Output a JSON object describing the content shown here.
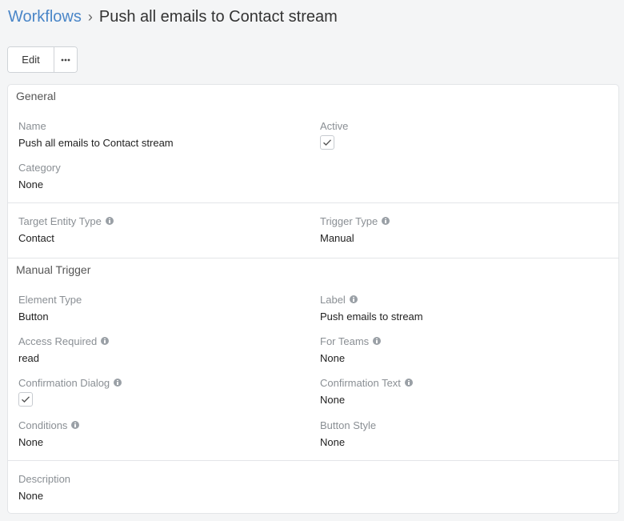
{
  "breadcrumb": {
    "parent": "Workflows",
    "separator": "›",
    "current": "Push all emails to Contact stream"
  },
  "toolbar": {
    "edit_label": "Edit",
    "more_icon": "more-horizontal-icon"
  },
  "general": {
    "title": "General",
    "name_label": "Name",
    "name_value": "Push all emails to Contact stream",
    "active_label": "Active",
    "active_checked": true,
    "category_label": "Category",
    "category_value": "None",
    "target_label": "Target Entity Type",
    "target_value": "Contact",
    "trigger_type_label": "Trigger Type",
    "trigger_type_value": "Manual"
  },
  "manual_trigger": {
    "title": "Manual Trigger",
    "element_type_label": "Element Type",
    "element_type_value": "Button",
    "label_label": "Label",
    "label_value": "Push emails to stream",
    "access_label": "Access Required",
    "access_value": "read",
    "teams_label": "For Teams",
    "teams_value": "None",
    "confirm_dialog_label": "Confirmation Dialog",
    "confirm_dialog_checked": true,
    "confirm_text_label": "Confirmation Text",
    "confirm_text_value": "None",
    "conditions_label": "Conditions",
    "conditions_value": "None",
    "button_style_label": "Button Style",
    "button_style_value": "None"
  },
  "description": {
    "label": "Description",
    "value": "None"
  },
  "colors": {
    "link": "#4a86c8",
    "label": "#8a8f94",
    "info_icon": "#9aa0a6"
  }
}
